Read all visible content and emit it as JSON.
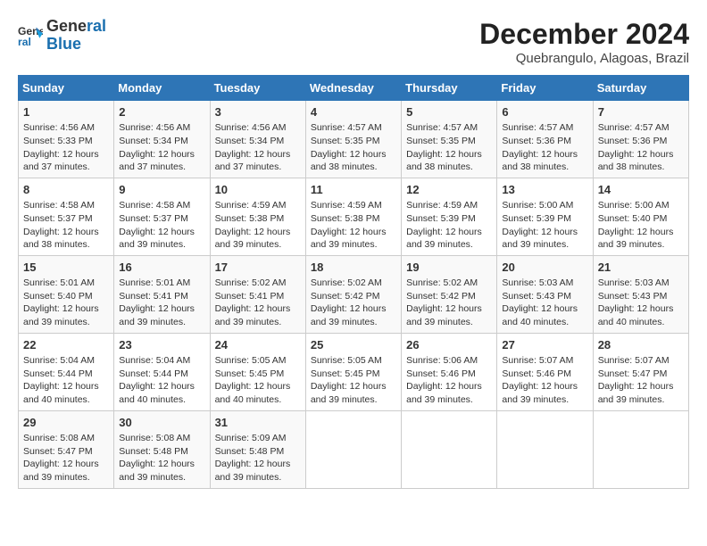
{
  "header": {
    "logo_line1": "General",
    "logo_line2": "Blue",
    "title": "December 2024",
    "subtitle": "Quebrangulo, Alagoas, Brazil"
  },
  "days_of_week": [
    "Sunday",
    "Monday",
    "Tuesday",
    "Wednesday",
    "Thursday",
    "Friday",
    "Saturday"
  ],
  "weeks": [
    [
      {
        "day": 1,
        "info": "Sunrise: 4:56 AM\nSunset: 5:33 PM\nDaylight: 12 hours\nand 37 minutes."
      },
      {
        "day": 2,
        "info": "Sunrise: 4:56 AM\nSunset: 5:34 PM\nDaylight: 12 hours\nand 37 minutes."
      },
      {
        "day": 3,
        "info": "Sunrise: 4:56 AM\nSunset: 5:34 PM\nDaylight: 12 hours\nand 37 minutes."
      },
      {
        "day": 4,
        "info": "Sunrise: 4:57 AM\nSunset: 5:35 PM\nDaylight: 12 hours\nand 38 minutes."
      },
      {
        "day": 5,
        "info": "Sunrise: 4:57 AM\nSunset: 5:35 PM\nDaylight: 12 hours\nand 38 minutes."
      },
      {
        "day": 6,
        "info": "Sunrise: 4:57 AM\nSunset: 5:36 PM\nDaylight: 12 hours\nand 38 minutes."
      },
      {
        "day": 7,
        "info": "Sunrise: 4:57 AM\nSunset: 5:36 PM\nDaylight: 12 hours\nand 38 minutes."
      }
    ],
    [
      {
        "day": 8,
        "info": "Sunrise: 4:58 AM\nSunset: 5:37 PM\nDaylight: 12 hours\nand 38 minutes."
      },
      {
        "day": 9,
        "info": "Sunrise: 4:58 AM\nSunset: 5:37 PM\nDaylight: 12 hours\nand 39 minutes."
      },
      {
        "day": 10,
        "info": "Sunrise: 4:59 AM\nSunset: 5:38 PM\nDaylight: 12 hours\nand 39 minutes."
      },
      {
        "day": 11,
        "info": "Sunrise: 4:59 AM\nSunset: 5:38 PM\nDaylight: 12 hours\nand 39 minutes."
      },
      {
        "day": 12,
        "info": "Sunrise: 4:59 AM\nSunset: 5:39 PM\nDaylight: 12 hours\nand 39 minutes."
      },
      {
        "day": 13,
        "info": "Sunrise: 5:00 AM\nSunset: 5:39 PM\nDaylight: 12 hours\nand 39 minutes."
      },
      {
        "day": 14,
        "info": "Sunrise: 5:00 AM\nSunset: 5:40 PM\nDaylight: 12 hours\nand 39 minutes."
      }
    ],
    [
      {
        "day": 15,
        "info": "Sunrise: 5:01 AM\nSunset: 5:40 PM\nDaylight: 12 hours\nand 39 minutes."
      },
      {
        "day": 16,
        "info": "Sunrise: 5:01 AM\nSunset: 5:41 PM\nDaylight: 12 hours\nand 39 minutes."
      },
      {
        "day": 17,
        "info": "Sunrise: 5:02 AM\nSunset: 5:41 PM\nDaylight: 12 hours\nand 39 minutes."
      },
      {
        "day": 18,
        "info": "Sunrise: 5:02 AM\nSunset: 5:42 PM\nDaylight: 12 hours\nand 39 minutes."
      },
      {
        "day": 19,
        "info": "Sunrise: 5:02 AM\nSunset: 5:42 PM\nDaylight: 12 hours\nand 39 minutes."
      },
      {
        "day": 20,
        "info": "Sunrise: 5:03 AM\nSunset: 5:43 PM\nDaylight: 12 hours\nand 40 minutes."
      },
      {
        "day": 21,
        "info": "Sunrise: 5:03 AM\nSunset: 5:43 PM\nDaylight: 12 hours\nand 40 minutes."
      }
    ],
    [
      {
        "day": 22,
        "info": "Sunrise: 5:04 AM\nSunset: 5:44 PM\nDaylight: 12 hours\nand 40 minutes."
      },
      {
        "day": 23,
        "info": "Sunrise: 5:04 AM\nSunset: 5:44 PM\nDaylight: 12 hours\nand 40 minutes."
      },
      {
        "day": 24,
        "info": "Sunrise: 5:05 AM\nSunset: 5:45 PM\nDaylight: 12 hours\nand 40 minutes."
      },
      {
        "day": 25,
        "info": "Sunrise: 5:05 AM\nSunset: 5:45 PM\nDaylight: 12 hours\nand 39 minutes."
      },
      {
        "day": 26,
        "info": "Sunrise: 5:06 AM\nSunset: 5:46 PM\nDaylight: 12 hours\nand 39 minutes."
      },
      {
        "day": 27,
        "info": "Sunrise: 5:07 AM\nSunset: 5:46 PM\nDaylight: 12 hours\nand 39 minutes."
      },
      {
        "day": 28,
        "info": "Sunrise: 5:07 AM\nSunset: 5:47 PM\nDaylight: 12 hours\nand 39 minutes."
      }
    ],
    [
      {
        "day": 29,
        "info": "Sunrise: 5:08 AM\nSunset: 5:47 PM\nDaylight: 12 hours\nand 39 minutes."
      },
      {
        "day": 30,
        "info": "Sunrise: 5:08 AM\nSunset: 5:48 PM\nDaylight: 12 hours\nand 39 minutes."
      },
      {
        "day": 31,
        "info": "Sunrise: 5:09 AM\nSunset: 5:48 PM\nDaylight: 12 hours\nand 39 minutes."
      },
      null,
      null,
      null,
      null
    ]
  ]
}
